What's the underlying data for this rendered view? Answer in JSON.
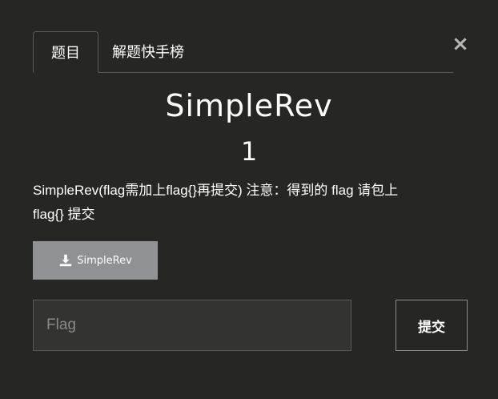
{
  "modal": {
    "close_label": "×",
    "tabs": [
      {
        "label": "题目",
        "active": true
      },
      {
        "label": "解题快手榜",
        "active": false
      }
    ],
    "challenge": {
      "name": "SimpleRev",
      "value": "1",
      "description_line1": "SimpleRev(flag需加上flag{}再提交) 注意：得到的 flag 请包上",
      "description_line2": "flag{} 提交"
    },
    "download": {
      "label": "SimpleRev",
      "icon": "download-icon"
    },
    "flag_input": {
      "placeholder": "Flag",
      "value": ""
    },
    "submit_label": "提交"
  },
  "colors": {
    "background": "#262624",
    "download_button": "#8f9192",
    "input_background": "#333331",
    "border": "#5a5a58"
  }
}
